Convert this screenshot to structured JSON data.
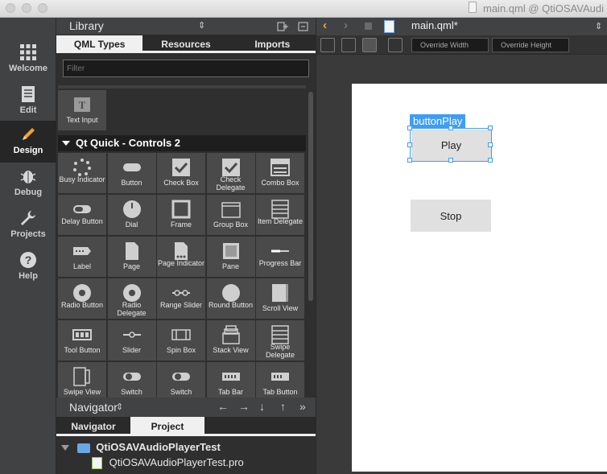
{
  "window": {
    "title": "main.qml @ QtiOSAVAudi"
  },
  "modes": [
    {
      "label": "Welcome",
      "icon": "grid-icon"
    },
    {
      "label": "Edit",
      "icon": "document-icon"
    },
    {
      "label": "Design",
      "icon": "pencil-icon"
    },
    {
      "label": "Debug",
      "icon": "bug-icon"
    },
    {
      "label": "Projects",
      "icon": "wrench-icon"
    },
    {
      "label": "Help",
      "icon": "question-icon"
    }
  ],
  "library": {
    "title": "Library",
    "tabs": [
      "QML Types",
      "Resources",
      "Imports"
    ],
    "filter_placeholder": "Filter",
    "text_input_label": "Text Input",
    "section_title": "Qt Quick - Controls 2",
    "controls": [
      "Busy Indicator",
      "Button",
      "Check Box",
      "Check Delegate",
      "Combo Box",
      "Delay Button",
      "Dial",
      "Frame",
      "Group Box",
      "Item Delegate",
      "Label",
      "Page",
      "Page Indicator",
      "Pane",
      "Progress Bar",
      "Radio Button",
      "Radio Delegate",
      "Range Slider",
      "Round Button",
      "Scroll View",
      "Tool Button",
      "Slider",
      "Spin Box",
      "Stack View",
      "Swipe Delegate",
      "Swipe View",
      "Switch",
      "Switch",
      "Tab Bar",
      "Tab Button"
    ]
  },
  "navigator": {
    "title": "Navigator",
    "tabs": [
      "Navigator",
      "Project"
    ],
    "project_name": "QtiOSAVAudioPlayerTest",
    "project_file": "QtiOSAVAudioPlayerTest.pro"
  },
  "editor": {
    "file_name": "main.qml*",
    "override_width_placeholder": "Override Width",
    "override_height_placeholder": "Override Height"
  },
  "canvas": {
    "selected_id": "buttonPlay",
    "play_label": "Play",
    "stop_label": "Stop",
    "selection_color": "#3d9df7"
  }
}
